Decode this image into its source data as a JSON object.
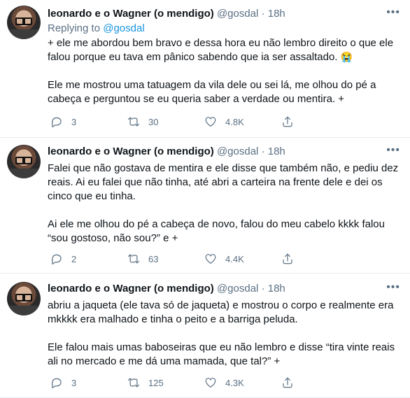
{
  "tweets": [
    {
      "author_name": "leonardo e o Wagner (o mendigo)",
      "handle": "@gosdal",
      "dot": "·",
      "time": "18h",
      "replying_prefix": "Replying to",
      "replying_to": "@gosdal",
      "paragraphs": [
        "+ ele me abordou bem bravo e dessa hora eu não lembro direito o que ele falou porque eu tava em pânico sabendo que ia ser assaltado.",
        "Ele me mostrou uma tatuagem da vila dele ou sei lá, me olhou do pé a cabeça e perguntou se eu queria saber a verdade ou mentira. +"
      ],
      "emoji": "😭",
      "replies": "3",
      "retweets": "30",
      "likes": "4.8K"
    },
    {
      "author_name": "leonardo e o Wagner (o mendigo)",
      "handle": "@gosdal",
      "dot": "·",
      "time": "18h",
      "paragraphs": [
        "Falei que não gostava de mentira e ele disse que também não, e pediu dez reais. Ai eu falei que não tinha, até abri a carteira na frente dele e dei os cinco que eu tinha.",
        "Ai ele me olhou do pé a cabeça de novo, falou do meu cabelo kkkk falou “sou gostoso, não sou?” e +"
      ],
      "replies": "2",
      "retweets": "63",
      "likes": "4.4K"
    },
    {
      "author_name": "leonardo e o Wagner (o mendigo)",
      "handle": "@gosdal",
      "dot": "·",
      "time": "18h",
      "paragraphs": [
        "abriu a jaqueta (ele tava só de jaqueta) e mostrou o corpo e realmente era mkkkk era malhado e tinha o peito e a barriga peluda.",
        "Ele falou mais umas baboseiras que eu não lembro e disse “tira vinte reais ali no mercado e me dá uma mamada, que tal?” +"
      ],
      "replies": "3",
      "retweets": "125",
      "likes": "4.3K"
    }
  ],
  "icons": {
    "more": "more-options-icon",
    "reply": "reply-icon",
    "retweet": "retweet-icon",
    "like": "heart-icon",
    "share": "share-icon"
  },
  "colors": {
    "text": "#0f1419",
    "secondary": "#5b7083",
    "link": "#1b95e0",
    "divider": "#e6ecf0"
  }
}
